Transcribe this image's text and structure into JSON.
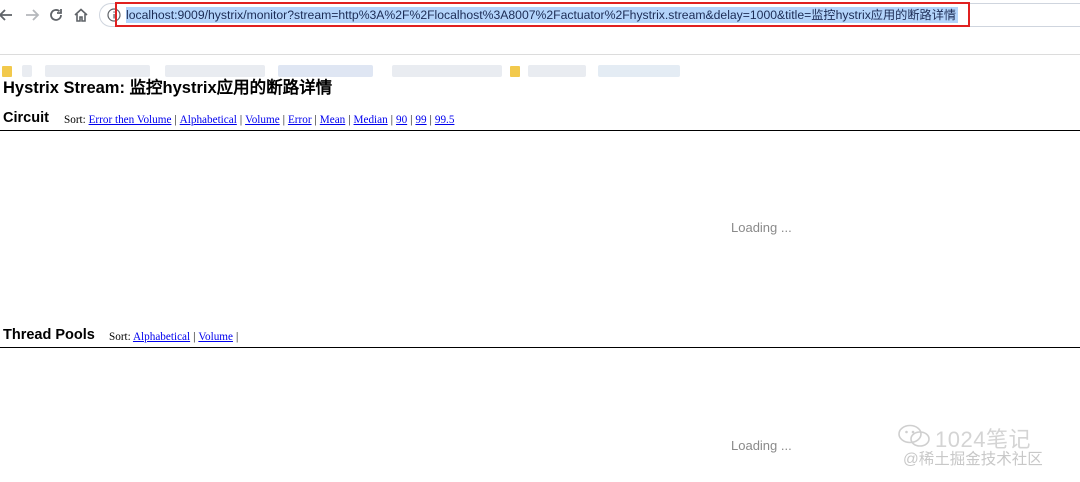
{
  "browser": {
    "url": "localhost:9009/hystrix/monitor?stream=http%3A%2F%2Flocalhost%3A8007%2Factuator%2Fhystrix.stream&delay=1000&title=监控hystrix应用的断路详情"
  },
  "page": {
    "title": "Hystrix Stream: 监控hystrix应用的断路详情"
  },
  "circuit": {
    "heading": "Circuit",
    "sort_label": "Sort:",
    "sort_options": [
      "Error then Volume",
      "Alphabetical",
      "Volume",
      "Error",
      "Mean",
      "Median",
      "90",
      "99",
      "99.5"
    ],
    "loading": "Loading ..."
  },
  "thread_pools": {
    "heading": "Thread Pools",
    "sort_label": "Sort:",
    "sort_options": [
      "Alphabetical",
      "Volume"
    ],
    "loading": "Loading ..."
  },
  "watermark": {
    "line1": "1024笔记",
    "line2": "@稀土掘金技术社区"
  }
}
